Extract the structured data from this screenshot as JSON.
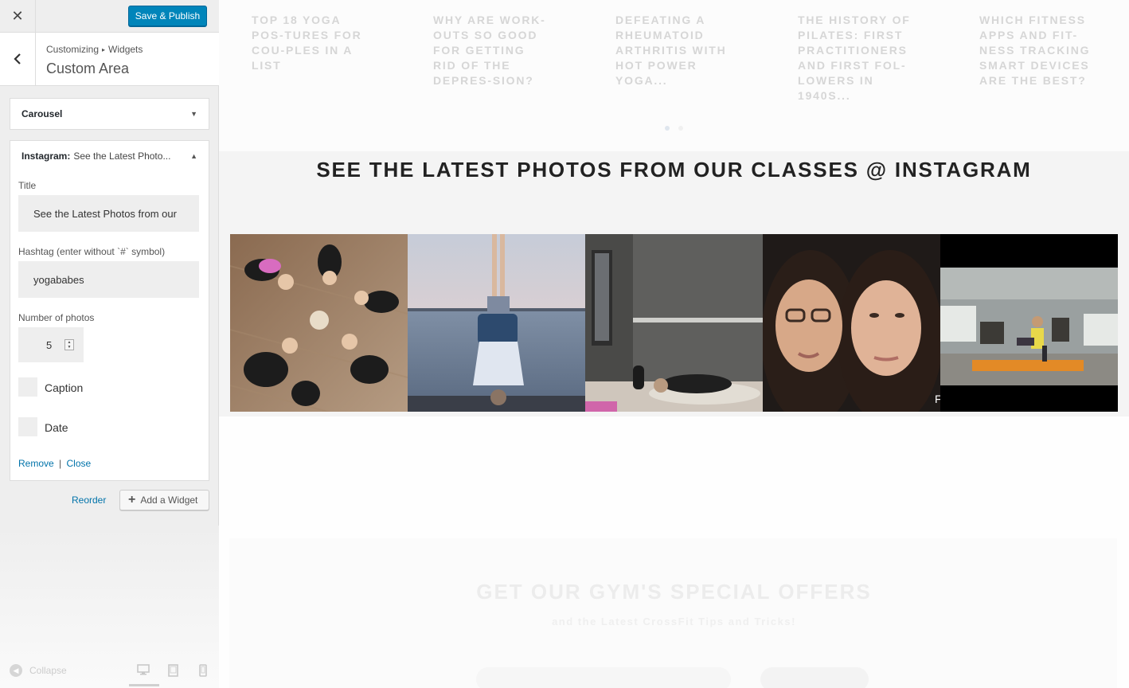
{
  "topbar": {
    "close_icon": "close-icon",
    "save_label": "Save & Publish"
  },
  "section": {
    "back_icon": "chevron-left-icon",
    "breadcrumb": [
      "Customizing",
      "Widgets"
    ],
    "title": "Custom Area"
  },
  "widgets": {
    "carousel": {
      "label": "Carousel"
    },
    "instagram": {
      "type_label": "Instagram:",
      "title_preview": "See the Latest Photo...",
      "fields": {
        "title_label": "Title",
        "title_value": "See the Latest Photos from our",
        "hashtag_label": "Hashtag (enter without `#` symbol)",
        "hashtag_value": "yogababes",
        "number_label": "Number of photos",
        "number_value": "5",
        "caption_label": "Caption",
        "date_label": "Date"
      },
      "actions": {
        "remove": "Remove",
        "separator": "|",
        "close": "Close"
      }
    }
  },
  "panel_actions": {
    "reorder": "Reorder",
    "add_widget": "Add a Widget"
  },
  "footer": {
    "collapse": "Collapse",
    "devices": [
      "desktop-icon",
      "tablet-icon",
      "mobile-icon"
    ]
  },
  "preview": {
    "posts": [
      "Top 18 Yoga Pos-tures for Cou-ples in a List",
      "Why Are Work-outs So Good for Getting Rid of the Depres-sion?",
      "Defeating a Rheumatoid Arthritis With Hot Power Yoga...",
      "The History of Pilates: First Practitioners and First Fol-lowers in 1940s...",
      "Which Fitness Apps and Fit-ness Tracking Smart Devices Are the Best?"
    ],
    "instagram_heading": "See the Latest Photos from our Classes @ Instagram",
    "offer_title": "Get Our Gym's Special Offers",
    "offer_subtitle": "and the Latest CrossFit Tips and Tricks!"
  },
  "colors": {
    "accent": "#0085ba",
    "link": "#0073aa",
    "sidebar_bg": "#eeeeee"
  }
}
